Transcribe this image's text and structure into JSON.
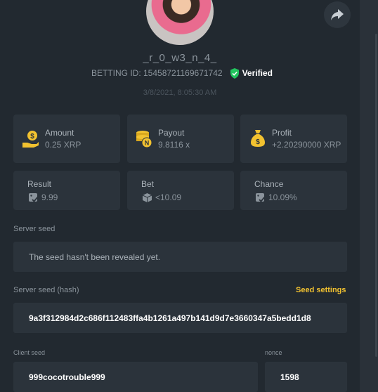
{
  "profile": {
    "username": "_r_0_w3_n_4_",
    "betting_id": "BETTING ID: 15458721169671742",
    "verified_label": "Verified",
    "timestamp": "3/8/2021, 8:05:30 AM"
  },
  "stats": {
    "amount": {
      "label": "Amount",
      "value": "0.25 XRP",
      "icon": "money-bag-hand-icon"
    },
    "payout": {
      "label": "Payout",
      "value": "9.8116 x",
      "icon": "coin-stack-icon"
    },
    "profit": {
      "label": "Profit",
      "value": "+2.20290000 XRP",
      "icon": "money-sack-icon"
    },
    "result": {
      "label": "Result",
      "value": "9.99",
      "icon": "dice-check-icon"
    },
    "bet": {
      "label": "Bet",
      "value": "<10.09",
      "icon": "dice-icon"
    },
    "chance": {
      "label": "Chance",
      "value": "10.09%",
      "icon": "dice-check-icon"
    }
  },
  "fairness": {
    "server_seed_label": "Server seed",
    "server_seed_value": "The seed hasn't been revealed yet.",
    "server_seed_hash_label": "Server seed (hash)",
    "seed_settings_label": "Seed settings",
    "server_seed_hash_value": "9a3f312984d2c686f112483ffa4b1261a497b141d9d7e3660347a5bedd1d8",
    "client_seed_label": "Client seed",
    "client_seed_value": "999cocotrouble999",
    "nonce_label": "nonce",
    "nonce_value": "1598"
  },
  "colors": {
    "accent": "#f2c230",
    "verified": "#22c55e",
    "background": "#222930",
    "card": "#2b333b"
  }
}
